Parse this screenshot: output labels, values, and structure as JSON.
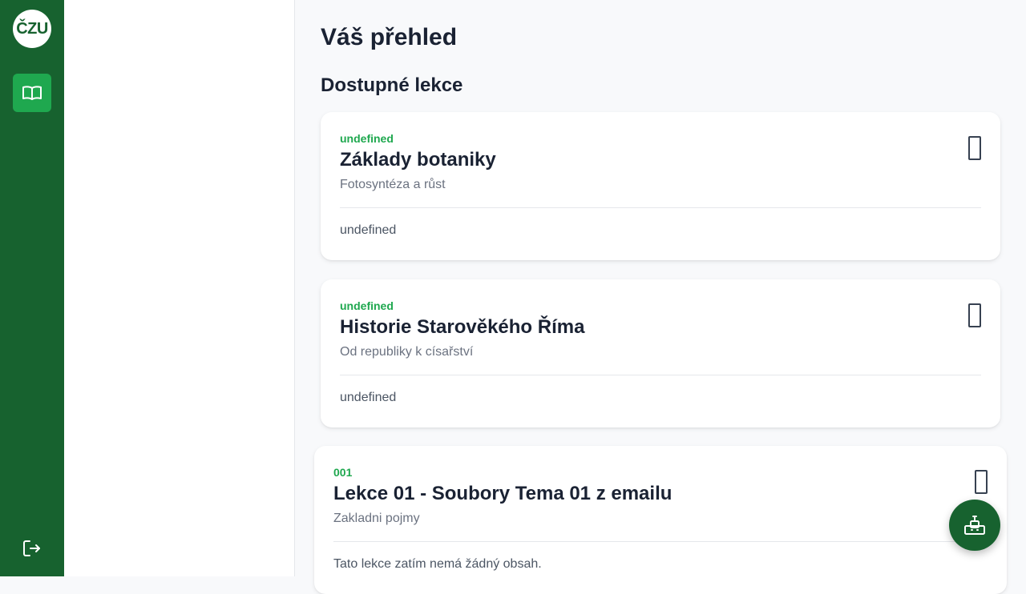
{
  "sidebar": {
    "logo_text": "ČZU",
    "nav_icon": "book-open-icon",
    "logout_icon": "logout-icon"
  },
  "header": {
    "title": "Váš přehled",
    "section_title": "Dostupné lekce"
  },
  "lessons": [
    {
      "code": "undefined",
      "title": "Základy botaniky",
      "subtitle": "Fotosyntéza a růst",
      "body": "undefined"
    },
    {
      "code": "undefined",
      "title": "Historie Starověkého Říma",
      "subtitle": "Od republiky k císařství",
      "body": "undefined"
    },
    {
      "code": "001",
      "title": "Lekce 01 - Soubory Tema 01 z emailu",
      "subtitle": "Zakladni pojmy",
      "body": "Tato lekce zatím nemá žádný obsah."
    }
  ],
  "fab": {
    "icon": "robot-assistant-icon"
  },
  "colors": {
    "rail": "#17622f",
    "accent": "#1fa84f",
    "heading": "#1a2233"
  }
}
